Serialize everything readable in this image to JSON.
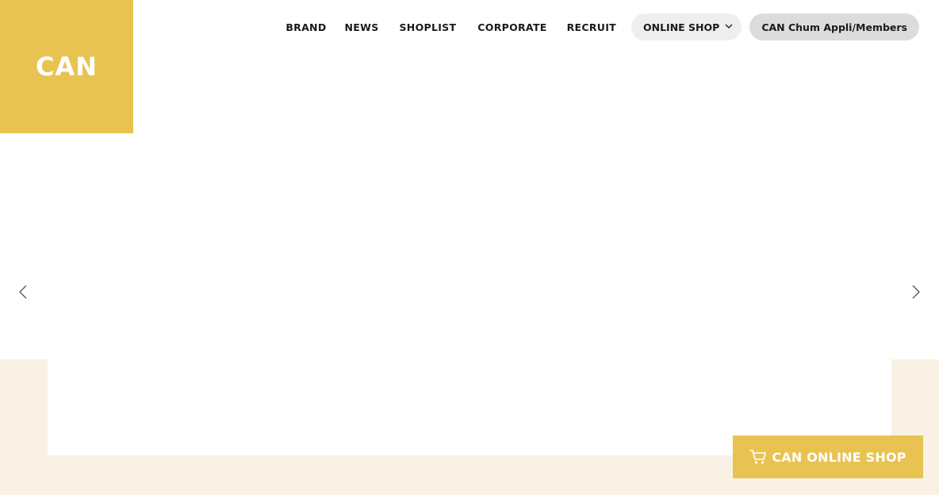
{
  "colors": {
    "brand_yellow": "#e8c351",
    "cream": "#f8f1e4",
    "text": "#1a1a1a",
    "pill_online_bg": "#eeeeee",
    "pill_members_bg": "#dcdcdc",
    "arrow": "#555555"
  },
  "header": {
    "logo_text": "CAN",
    "nav": {
      "brand": "BRAND",
      "news": "NEWS",
      "shoplist": "SHOPLIST",
      "corporate": "CORPORATE",
      "recruit": "RECRUIT",
      "online_shop": "ONLINE SHOP",
      "online_shop_icon": "chevron-down-icon",
      "members": "CAN Chum Appli/Members"
    }
  },
  "slider": {
    "prev_icon": "chevron-left-icon",
    "next_icon": "chevron-right-icon"
  },
  "floating_button": {
    "icon": "cart-icon",
    "label": "CAN ONLINE SHOP"
  }
}
